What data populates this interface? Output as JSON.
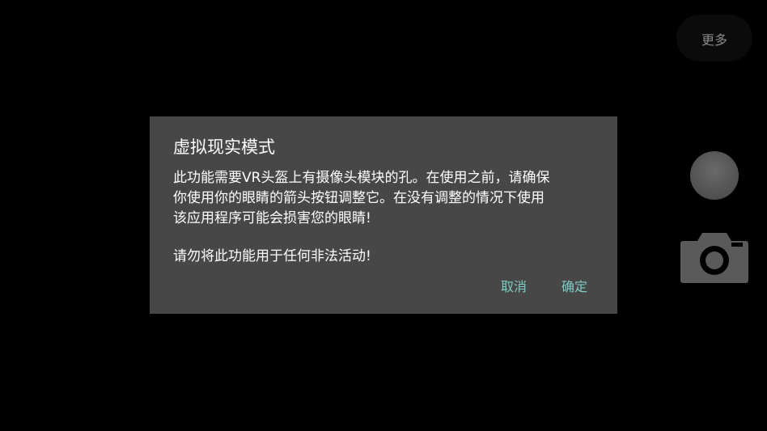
{
  "camera_controls": {
    "more_label": "更多"
  },
  "dialog": {
    "title": "虚拟现实模式",
    "body_paragraph_1": "此功能需要VR头盔上有摄像头模块的孔。在使用之前，请确保\n你使用你的眼睛的箭头按钮调整它。在没有调整的情况下使用\n该应用程序可能会损害您的眼睛!",
    "body_paragraph_2": "请勿将此功能用于任何非法活动!",
    "cancel_label": "取消",
    "confirm_label": "确定"
  },
  "colors": {
    "background": "#000000",
    "dialog_background": "#474747",
    "button_text": "#80cbc4",
    "more_text": "#8a8a8a",
    "control_gray": "#5a5a5a"
  },
  "icons": {
    "shutter": "shutter-button-icon",
    "camera": "camera-icon"
  }
}
